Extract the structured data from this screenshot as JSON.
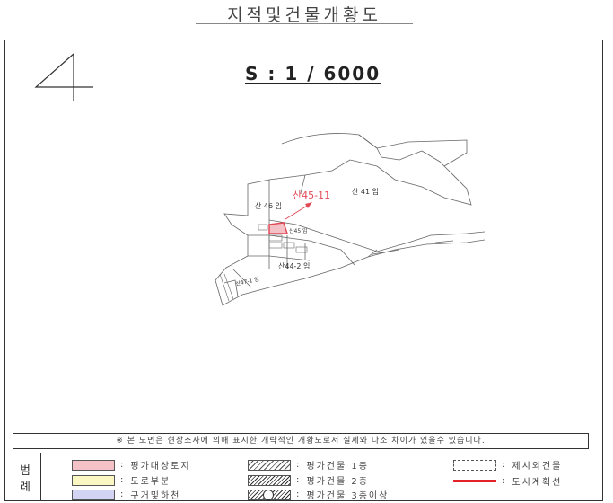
{
  "title": "지적및건물개황도",
  "scale": "S : 1 / 6000",
  "map_labels": {
    "parcel_main": "산45-11",
    "forest_41": "산 41 임",
    "forest_46": "산 46 임",
    "forest_45": "산45 임",
    "forest_44_2": "산44-2 임",
    "forest_47_1": "산47-1 임"
  },
  "notice": "※ 본 도면은 현장조사에 의해 표시한 개략적인 개황도로서 실제와 다소 차이가 있을수 있습니다.",
  "legend": {
    "title": "범례",
    "items": [
      {
        "label": "평가대상토지",
        "color": "#f4c2c6"
      },
      {
        "label": "도로부분",
        "color": "#fbf7c3"
      },
      {
        "label": "구거및하천",
        "color": "#d3d3f4"
      },
      {
        "label": "평가건물 1층"
      },
      {
        "label": "평가건물 2층"
      },
      {
        "label": "평가건물 3층이상"
      },
      {
        "label": "제시외건물"
      },
      {
        "label": "도시계획선",
        "color": "#e2232a"
      }
    ]
  },
  "colors": {
    "subject_parcel": "#e24a58",
    "subject_fill": "#f4c2c6",
    "parcel_lines": "#555555"
  }
}
